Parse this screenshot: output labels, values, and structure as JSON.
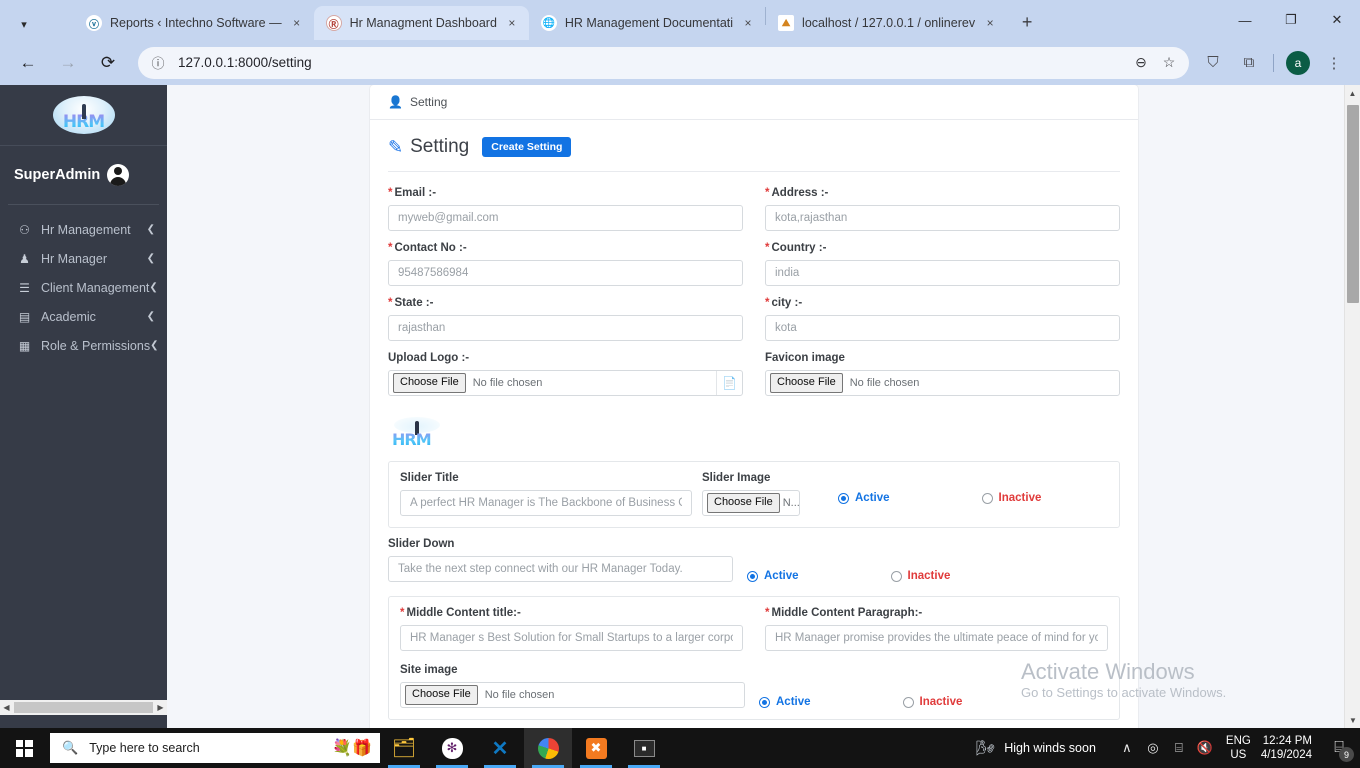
{
  "browser": {
    "tab_list_icon": "chevron-down-icon",
    "tabs": [
      {
        "title": "Reports ‹ Intechno Software —",
        "favicon": "wordpress-icon",
        "active": false,
        "close_label": "×"
      },
      {
        "title": "Hr Managment Dashboard",
        "favicon": "hrm-icon",
        "active": true,
        "close_label": "×"
      },
      {
        "title": "HR Management Documentati",
        "favicon": "globe-icon",
        "active": false,
        "close_label": "×"
      },
      {
        "title": "localhost / 127.0.0.1 / onlinerev",
        "favicon": "phpmyadmin-icon",
        "active": false,
        "close_label": "×"
      }
    ],
    "new_tab_label": "+",
    "window_controls": {
      "minimize": "—",
      "maximize": "❐",
      "close": "✕"
    },
    "toolbar": {
      "back_label": "←",
      "forward_label": "→",
      "reload_label": "⟳",
      "site_info_icon": "info-circle-icon",
      "url": "127.0.0.1:8000/setting",
      "zoom_out_label": "⊖",
      "bookmark_label": "☆",
      "shield_label": "⛉",
      "extensions_label": "⧉",
      "profile_initial": "a",
      "menu_label": "⋮"
    }
  },
  "sidebar": {
    "logo_text": "HRM",
    "user_name": "SuperAdmin",
    "avatar_icon": "user-avatar-icon",
    "items": [
      {
        "label": "Hr Management",
        "icon": "dashboard-icon",
        "glyph": "⚇",
        "caret": "❮"
      },
      {
        "label": "Hr Manager",
        "icon": "user-icon",
        "glyph": "♟",
        "caret": "❮"
      },
      {
        "label": "Client Management",
        "icon": "list-icon",
        "glyph": "☰",
        "caret": "❮"
      },
      {
        "label": "Academic",
        "icon": "briefcase-icon",
        "glyph": "▤",
        "caret": "❮"
      },
      {
        "label": "Role & Permissions",
        "icon": "table-icon",
        "glyph": "▦",
        "caret": "❮"
      }
    ],
    "hscroll": {
      "left_arrow": "◀",
      "right_arrow": "▶"
    }
  },
  "page": {
    "breadcrumb": {
      "icon": "user-gear-icon",
      "label": "Setting"
    },
    "title": "Setting",
    "title_icon": "edit-square-icon",
    "create_button": "Create Setting",
    "fields": {
      "email": {
        "label": "Email :-",
        "required": true,
        "value": "myweb@gmail.com"
      },
      "address": {
        "label": "Address :-",
        "required": true,
        "value": "kota,rajasthan"
      },
      "contact": {
        "label": "Contact No :-",
        "required": true,
        "value": "95487586984"
      },
      "country": {
        "label": "Country :-",
        "required": true,
        "value": "india"
      },
      "state": {
        "label": "State :-",
        "required": true,
        "value": "rajasthan"
      },
      "city": {
        "label": "city :-",
        "required": true,
        "value": "kota"
      },
      "upload_logo": {
        "label": "Upload Logo :-",
        "button": "Choose File",
        "status": "No file chosen",
        "side_icon": "file-icon"
      },
      "favicon": {
        "label": "Favicon image",
        "button": "Choose File",
        "status": "No file chosen"
      },
      "slider_title": {
        "label": "Slider Title",
        "value": "A perfect HR Manager is The Backbone of Business Growth."
      },
      "slider_image": {
        "label": "Slider Image",
        "button": "Choose File",
        "status": "N...n"
      },
      "slider_down": {
        "label": "Slider Down",
        "value": "Take the next step connect with our HR Manager Today."
      },
      "middle_title": {
        "label": "Middle Content title:-",
        "required": true,
        "value": "HR Manager s Best Solution for Small Startups to a larger corporation"
      },
      "middle_paragraph": {
        "label": "Middle Content Paragraph:-",
        "required": true,
        "value": "HR Manager promise provides the ultimate peace of mind for your busines"
      },
      "site_image": {
        "label": "Site image",
        "button": "Choose File",
        "status": "No file chosen"
      }
    },
    "radios": {
      "active_label": "Active",
      "inactive_label": "Inactive",
      "slider_image_selected": "Active",
      "slider_down_selected": "Active",
      "site_image_selected": "Active"
    },
    "logo_preview_text": "HRM",
    "required_marker": "*",
    "colors": {
      "accent_blue": "#1273e3",
      "danger_red": "#e03b3b",
      "sidebar_bg": "#363b47",
      "page_bg": "#f4f6fa"
    }
  },
  "watermark": {
    "title": "Activate Windows",
    "subtitle": "Go to Settings to activate Windows."
  },
  "taskbar": {
    "start_label": "Start",
    "search_placeholder": "Type here to search",
    "search_decor": "💐🎁",
    "apps": [
      {
        "name": "file-explorer",
        "glyph": "🗂",
        "running": true,
        "active": false
      },
      {
        "name": "slack",
        "glyph": "✻",
        "running": true,
        "active": false
      },
      {
        "name": "vs-code",
        "glyph": "✕",
        "running": true,
        "active": false
      },
      {
        "name": "google-chrome",
        "glyph": "◉",
        "running": true,
        "active": true
      },
      {
        "name": "xampp",
        "glyph": "✖",
        "running": true,
        "active": false
      },
      {
        "name": "command-prompt",
        "glyph": "■",
        "running": true,
        "active": false
      }
    ],
    "weather": {
      "icon": "wind-icon",
      "text": "High winds soon"
    },
    "tray": {
      "show_hidden": "∧",
      "camera_icon": "◎",
      "network_icon": "⌸",
      "volume_icon": "🔇"
    },
    "language": {
      "line1": "ENG",
      "line2": "US"
    },
    "clock": {
      "time": "12:24 PM",
      "date": "4/19/2024"
    },
    "notifications": {
      "icon": "⌸",
      "count": "9"
    }
  }
}
